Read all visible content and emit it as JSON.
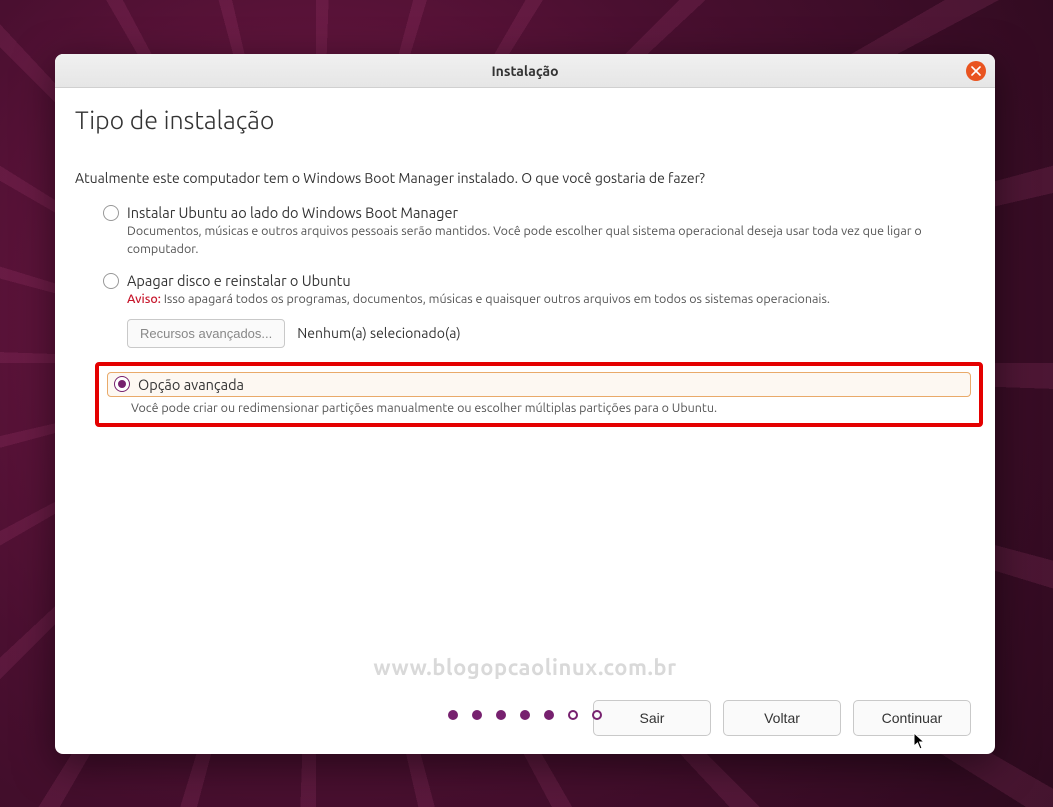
{
  "window": {
    "title": "Instalação"
  },
  "heading": "Tipo de instalação",
  "prompt": "Atualmente este computador tem o Windows Boot Manager instalado. O que você gostaria de fazer?",
  "options": {
    "alongside": {
      "label": "Instalar Ubuntu ao lado do Windows Boot Manager",
      "desc": "Documentos, músicas e outros arquivos pessoais serão mantidos. Você pode escolher qual sistema operacional deseja usar toda vez que ligar o computador.",
      "selected": false
    },
    "erase": {
      "label": "Apagar disco e reinstalar o Ubuntu",
      "warn_label": "Aviso:",
      "warn_text": " Isso apagará todos os programas, documentos, músicas e quaisquer outros arquivos em todos os sistemas operacionais.",
      "selected": false,
      "advanced_btn": "Recursos avançados...",
      "advanced_status": "Nenhum(a) selecionado(a)"
    },
    "advanced": {
      "label": "Opção avançada",
      "desc": "Você pode criar ou redimensionar partições manualmente ou escolher múltiplas partições para o Ubuntu.",
      "selected": true
    }
  },
  "buttons": {
    "quit": "Sair",
    "back": "Voltar",
    "continue": "Continuar"
  },
  "watermark": "www.blogopcaolinux.com.br",
  "progress": {
    "total": 7,
    "current": 5
  }
}
